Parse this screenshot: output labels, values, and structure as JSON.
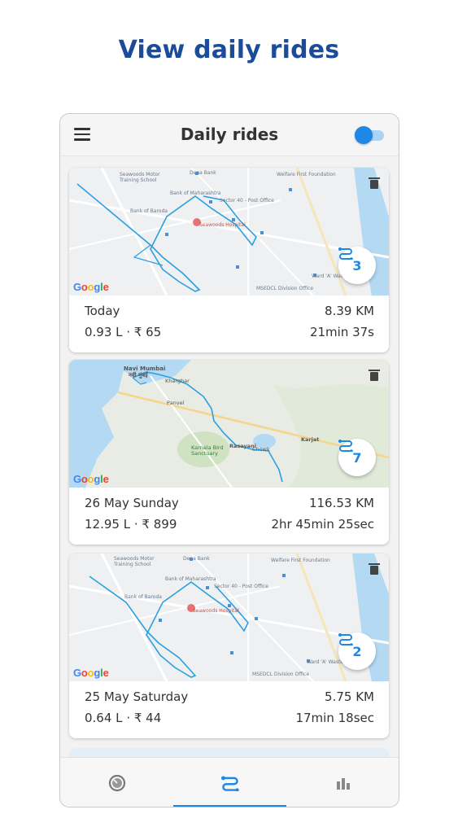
{
  "headline": "View daily rides",
  "app": {
    "title": "Daily rides",
    "toggle_color": "#1e88e5"
  },
  "rides": [
    {
      "day": "Today",
      "distance": "8.39 KM",
      "fuel": "0.93 L",
      "cost": "₹ 65",
      "duration": "21min 37s",
      "trips": "3"
    },
    {
      "day": "26 May Sunday",
      "distance": "116.53 KM",
      "fuel": "12.95 L",
      "cost": "₹ 899",
      "duration": "2hr 45min 25sec",
      "trips": "7"
    },
    {
      "day": "25 May Saturday",
      "distance": "5.75 KM",
      "fuel": "0.64 L",
      "cost": "₹ 44",
      "duration": "17min 18sec",
      "trips": "2"
    }
  ],
  "separator": "·",
  "map_brand": "Google",
  "map_labels": {
    "top_a": [
      "Seawoods Motor Training School",
      "Dena Bank",
      "Bank of Maharashtra",
      "Bank of Baroda",
      "Sector 40 - Post Office",
      "Seawoods Hospital",
      "Welfare First Foundation",
      "MSEDCL Division Office",
      "Ward 'A' Waste Treatment Plant"
    ],
    "middle": [
      "Navi Mumbai",
      "नवी मुंबई",
      "Kharghar",
      "Panvel",
      "Karnala Bird Sanctuary",
      "Rasayani",
      "Chowk",
      "Karjat"
    ]
  },
  "nav": [
    {
      "icon": "speedometer-icon"
    },
    {
      "icon": "route-icon",
      "active": true
    },
    {
      "icon": "bar-chart-icon"
    }
  ],
  "colors": {
    "accent": "#1e88e5",
    "headline": "#1a4c9a",
    "route": "#2aa0e0",
    "water": "#b3d9f3"
  }
}
